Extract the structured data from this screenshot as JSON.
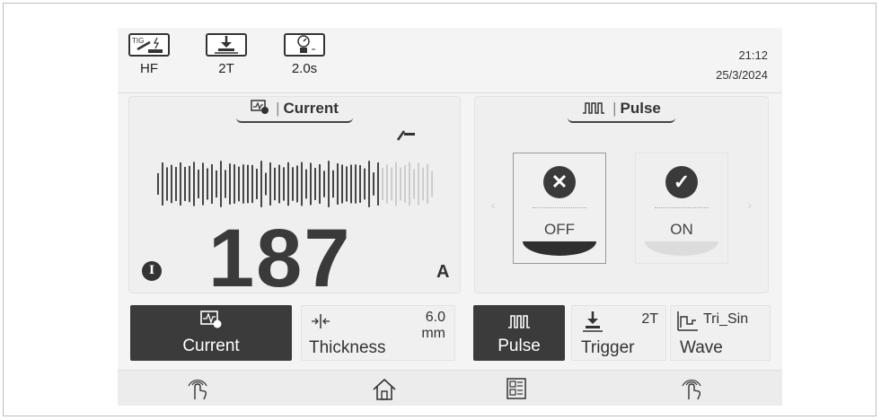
{
  "status": {
    "mode": {
      "icon": "tig-torch-icon",
      "label": "HF",
      "icon_text": "TIG"
    },
    "trigger": {
      "icon": "trigger-icon",
      "label": "2T"
    },
    "gas": {
      "icon": "gas-flow-icon",
      "label": "2.0s"
    },
    "time": "21:12",
    "date": "25/3/2024"
  },
  "current_panel": {
    "title": "Current",
    "value": "187",
    "unit": "A",
    "badge": "I"
  },
  "pulse_panel": {
    "title": "Pulse",
    "off_label": "OFF",
    "on_label": "ON",
    "selected": "OFF"
  },
  "bottom_buttons": {
    "current": {
      "label": "Current"
    },
    "thickness": {
      "label": "Thickness",
      "value": "6.0",
      "unit": "mm"
    },
    "pulse": {
      "label": "Pulse"
    },
    "trigger": {
      "label": "Trigger",
      "value": "2T"
    },
    "wave": {
      "label": "Wave",
      "value": "Tri_Sin"
    }
  },
  "nav": [
    "remote-touch-icon",
    "home-icon",
    "menu-grid-icon",
    "remote-touch-icon"
  ],
  "colors": {
    "dark": "#3b3b3b",
    "panel": "#efefef",
    "accent": "#333333"
  }
}
